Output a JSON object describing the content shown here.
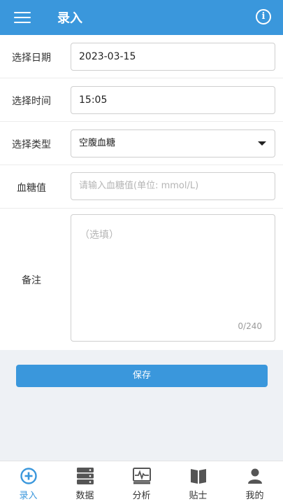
{
  "header": {
    "title": "录入"
  },
  "form": {
    "date": {
      "label": "选择日期",
      "value": "2023-03-15"
    },
    "time": {
      "label": "选择时间",
      "value": "15:05"
    },
    "type": {
      "label": "选择类型",
      "value": "空腹血糖"
    },
    "glucose": {
      "label": "血糖值",
      "placeholder": "请输入血糖值(单位: mmol/L)"
    },
    "note": {
      "label": "备注",
      "placeholder": "（选填）",
      "counter": "0/240"
    }
  },
  "save_label": "保存",
  "tabs": [
    {
      "label": "录入",
      "icon": "plus-circle-icon",
      "active": true
    },
    {
      "label": "数据",
      "icon": "server-icon",
      "active": false
    },
    {
      "label": "分析",
      "icon": "pulse-chart-icon",
      "active": false
    },
    {
      "label": "贴士",
      "icon": "book-icon",
      "active": false
    },
    {
      "label": "我的",
      "icon": "person-icon",
      "active": false
    }
  ],
  "colors": {
    "primary": "#3a97dc",
    "background": "#eef1f5"
  }
}
